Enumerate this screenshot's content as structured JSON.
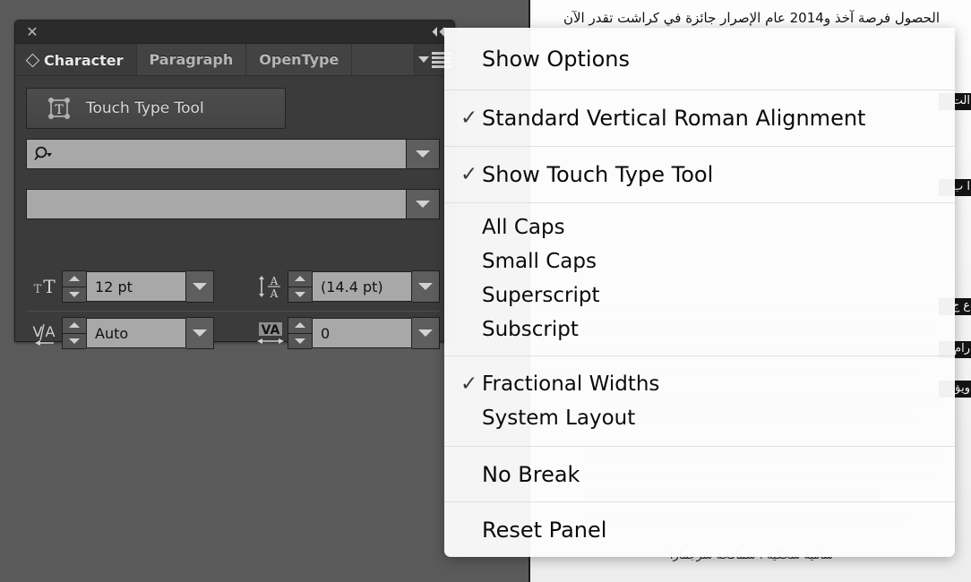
{
  "app": {
    "panel": {
      "close_icon": "close-icon",
      "collapse_icon": "collapse-double-arrow-icon",
      "tabs": [
        {
          "label": "Character",
          "active": true
        },
        {
          "label": "Paragraph",
          "active": false
        },
        {
          "label": "OpenType",
          "active": false
        }
      ],
      "panel_menu_icon": "panel-menu-icon",
      "touch_type_tool": {
        "label": "Touch Type Tool",
        "icon": "touch-type-tool-icon"
      },
      "font_family_field": {
        "value": "",
        "placeholder": "",
        "icon": "search-icon"
      },
      "font_style_field": {
        "value": "",
        "placeholder": ""
      },
      "metrics": [
        {
          "icon": "font-size-icon",
          "name": "font-size",
          "value": "12 pt"
        },
        {
          "icon": "leading-icon",
          "name": "leading",
          "value": "(14.4 pt)"
        },
        {
          "icon": "kerning-icon",
          "name": "kerning",
          "value": "Auto"
        },
        {
          "icon": "tracking-icon",
          "name": "tracking",
          "value": "0"
        }
      ]
    },
    "context_menu": {
      "groups": [
        {
          "items": [
            {
              "label": "Show Options",
              "checked": false,
              "size": "large"
            }
          ]
        },
        {
          "items": [
            {
              "label": "Standard Vertical Roman Alignment",
              "checked": true,
              "size": "large"
            }
          ]
        },
        {
          "items": [
            {
              "label": "Show Touch Type Tool",
              "checked": true,
              "size": "large"
            }
          ]
        },
        {
          "items": [
            {
              "label": "All Caps",
              "checked": false,
              "size": "compact"
            },
            {
              "label": "Small Caps",
              "checked": false,
              "size": "compact"
            },
            {
              "label": "Superscript",
              "checked": false,
              "size": "compact"
            },
            {
              "label": "Subscript",
              "checked": false,
              "size": "compact"
            }
          ]
        },
        {
          "items": [
            {
              "label": "Fractional Widths",
              "checked": true,
              "size": "compact"
            },
            {
              "label": "System Layout",
              "checked": false,
              "size": "compact"
            }
          ]
        },
        {
          "items": [
            {
              "label": "No Break",
              "checked": false,
              "size": "large"
            }
          ]
        },
        {
          "items": [
            {
              "label": "Reset Panel",
              "checked": false,
              "size": "large"
            }
          ]
        }
      ],
      "check_glyph": "✓"
    }
  },
  "document": {
    "top_line": "الحصول فرصة آخذ و2014 عام الإصرار جائزة في كراشت تقدر الآن",
    "bottom_line": "شامية شحكية . شمافحة شرجمارا",
    "highlights": [
      {
        "text": "الت"
      },
      {
        "text": "ا ب"
      },
      {
        "text": "ع ج"
      },
      {
        "text": "رام"
      },
      {
        "text": "ويق"
      }
    ]
  },
  "colors": {
    "panel_bg": "#3b3b3b",
    "panel_titlebar": "#2b2b2b",
    "tabbar": "#434343",
    "field_bg": "#a8a8a8",
    "desktop": "#5a5a5a",
    "menu_bg": "#fcfcfc",
    "menu_text": "#0a0a0a",
    "highlight_bg": "#141414"
  }
}
